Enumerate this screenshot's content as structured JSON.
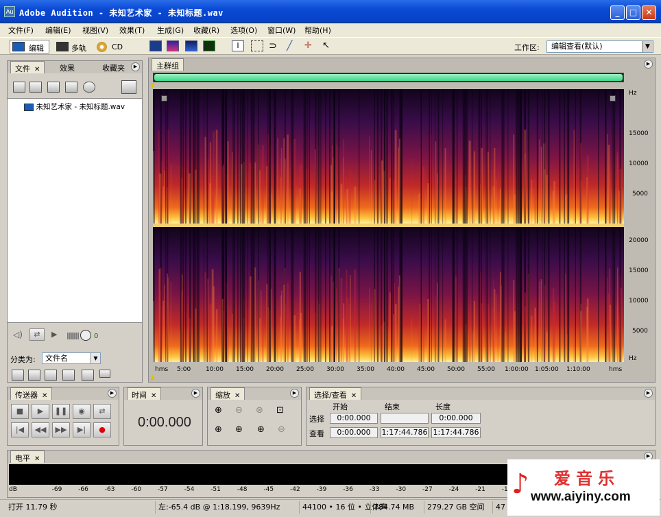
{
  "window": {
    "title": "Adobe Audition - 未知艺术家 - 未知标题.wav",
    "app_icon": "Au"
  },
  "menu": [
    "文件(F)",
    "编辑(E)",
    "视图(V)",
    "效果(T)",
    "生成(G)",
    "收藏(R)",
    "选项(O)",
    "窗口(W)",
    "帮助(H)"
  ],
  "toolbar": {
    "edit": "编辑",
    "multitrack": "多轨",
    "cd": "CD",
    "workspace_label": "工作区:",
    "workspace_value": "编辑查看(默认)"
  },
  "files_panel": {
    "tabs": [
      "文件",
      "效果",
      "收藏夹"
    ],
    "items": [
      "未知艺术家 - 未知标题.wav"
    ],
    "sort_label": "分类为:",
    "sort_value": "文件名",
    "volume_value": "0"
  },
  "main_panel": {
    "tab": "主群组"
  },
  "hz_top": [
    "Hz",
    "15000",
    "10000",
    "5000"
  ],
  "hz_bottom": [
    "20000",
    "15000",
    "10000",
    "5000",
    "Hz"
  ],
  "timeline": [
    "hms",
    "5:00",
    "10:00",
    "15:00",
    "20:00",
    "25:00",
    "30:00",
    "35:00",
    "40:00",
    "45:00",
    "50:00",
    "55:00",
    "1:00:00",
    "1:05:00",
    "1:10:00",
    "hms"
  ],
  "transport": {
    "tab": "传送器"
  },
  "time_panel": {
    "tab": "时间",
    "value": "0:00.000"
  },
  "zoom_panel": {
    "tab": "缩放"
  },
  "selection_panel": {
    "tab": "选择/查看",
    "col_start": "开始",
    "col_end": "结束",
    "col_length": "长度",
    "row_select": "选择",
    "row_view": "查看",
    "sel_start": "0:00.000",
    "sel_end": "",
    "sel_length": "0:00.000",
    "view_start": "0:00.000",
    "view_end": "1:17:44.786",
    "view_length": "1:17:44.786"
  },
  "level_panel": {
    "tab": "电平",
    "scale": [
      "dB",
      "-69",
      "-66",
      "-63",
      "-60",
      "-57",
      "-54",
      "-51",
      "-48",
      "-45",
      "-42",
      "-39",
      "-36",
      "-33",
      "-30",
      "-27",
      "-24",
      "-21",
      "-18"
    ]
  },
  "status": {
    "open": "打开 11.79 秒",
    "cursor": "左:-65.4 dB @ 1:18.199, 9639Hz",
    "format": "44100 • 16 位 • 立体声",
    "size": "784.74 MB",
    "free": "279.27 GB 空间",
    "extra": "47"
  },
  "watermark": {
    "text": "爱音乐",
    "url": "www.aiyiny.com"
  },
  "colors": {
    "titlebar": "#0a4ad6",
    "spectro_dark": "#0d0318",
    "spectro_hot": "#ffd24a"
  }
}
